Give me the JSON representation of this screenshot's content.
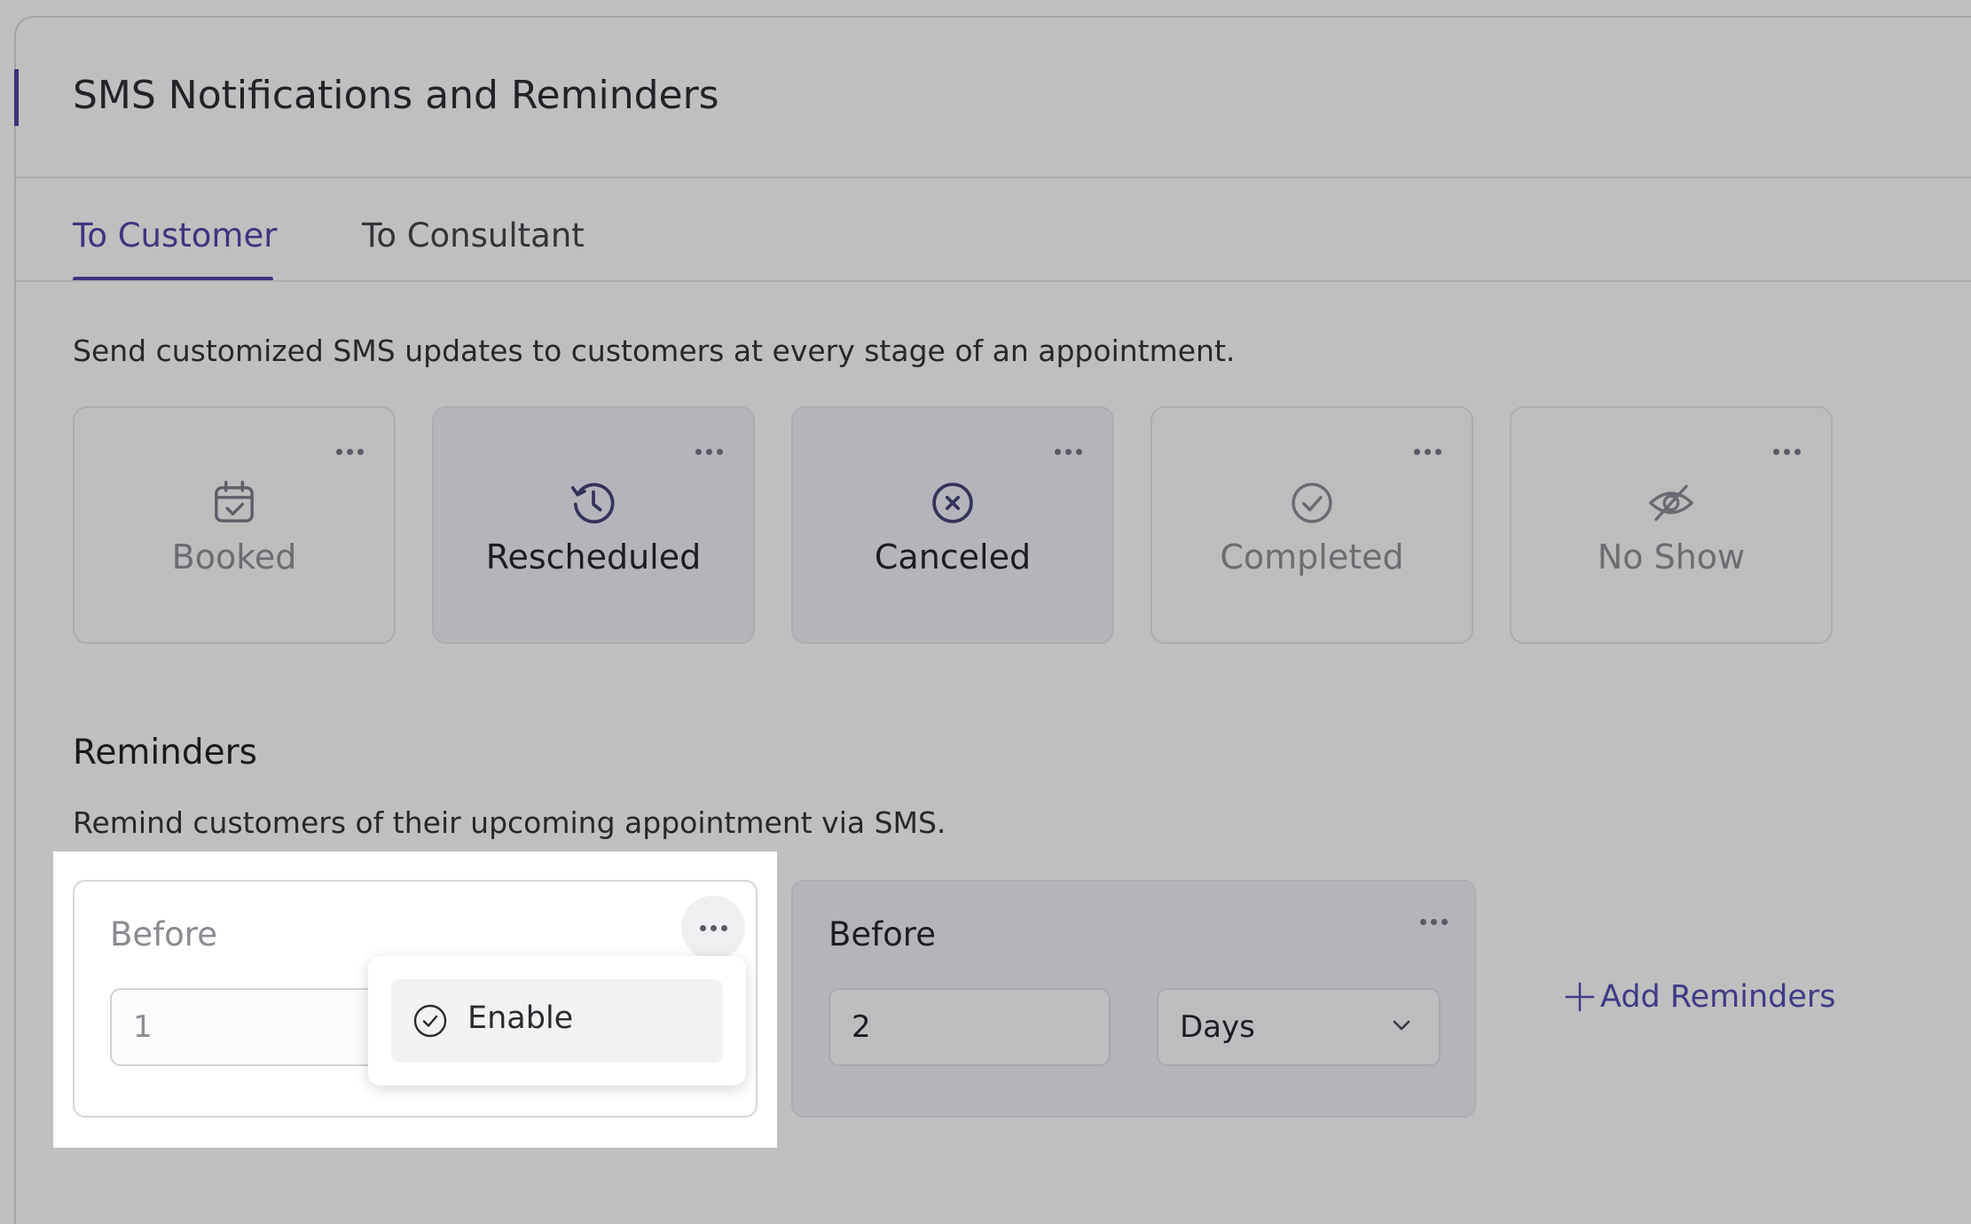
{
  "header": {
    "title": "SMS Notifications and Reminders"
  },
  "tabs": [
    {
      "label": "To Customer",
      "active": true
    },
    {
      "label": "To Consultant",
      "active": false
    }
  ],
  "notifications": {
    "description": "Send customized SMS updates to customers at every stage of an appointment.",
    "cards": [
      {
        "label": "Booked",
        "icon": "calendar-check-icon"
      },
      {
        "label": "Rescheduled",
        "icon": "history-clock-icon"
      },
      {
        "label": "Canceled",
        "icon": "circle-x-icon"
      },
      {
        "label": "Completed",
        "icon": "circle-check-icon"
      },
      {
        "label": "No Show",
        "icon": "eye-off-icon"
      }
    ]
  },
  "reminders": {
    "title": "Reminders",
    "description": "Remind customers of their upcoming appointment via SMS.",
    "items": [
      {
        "label": "Before",
        "value": "1"
      },
      {
        "label": "Before",
        "value": "2",
        "unit": "Days"
      }
    ],
    "menu": {
      "enable_label": "Enable"
    },
    "add_label": "Add Reminders"
  },
  "colors": {
    "accent": "#3d3580",
    "overlay_bg": "#bfbfbf",
    "highlight": "#ffffff"
  }
}
